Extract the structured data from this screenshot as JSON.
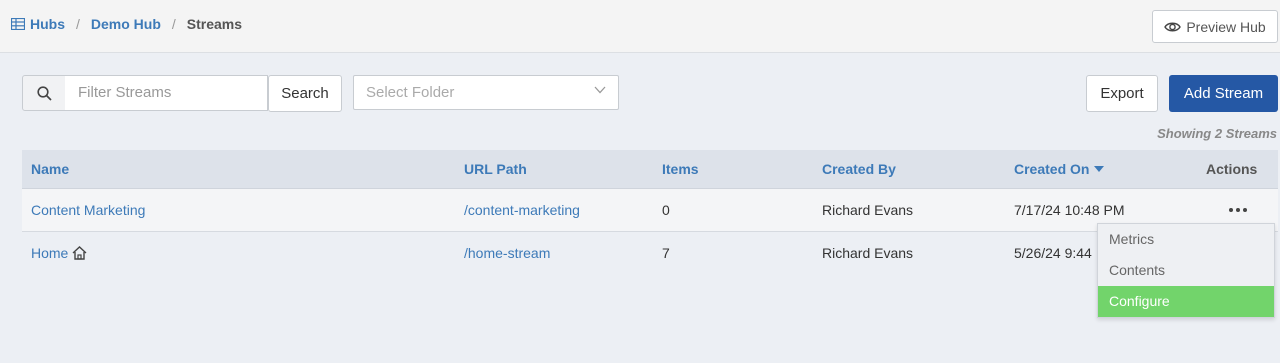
{
  "breadcrumb": {
    "items": [
      "Hubs",
      "Demo Hub",
      "Streams"
    ],
    "separator": "/"
  },
  "header": {
    "preview_label": "Preview Hub"
  },
  "toolbar": {
    "search_placeholder": "Filter Streams",
    "search_label": "Search",
    "folder_placeholder": "Select Folder",
    "export_label": "Export",
    "add_label": "Add Stream"
  },
  "showing_text": "Showing 2 Streams",
  "table": {
    "columns": [
      "Name",
      "URL Path",
      "Items",
      "Created By",
      "Created On",
      "Actions"
    ],
    "rows": [
      {
        "name": "Content Marketing",
        "url": "/content-marketing",
        "items": "0",
        "created_by": "Richard Evans",
        "created_on": "7/17/24 10:48 PM"
      },
      {
        "name": "Home",
        "url": "/home-stream",
        "items": "7",
        "created_by": "Richard Evans",
        "created_on": "5/26/24 9:44"
      }
    ]
  },
  "menu": {
    "items": [
      "Metrics",
      "Contents",
      "Configure"
    ]
  },
  "colors": {
    "accent": "#2558a5",
    "link": "#3d7ab8",
    "highlight": "#72d46b"
  }
}
